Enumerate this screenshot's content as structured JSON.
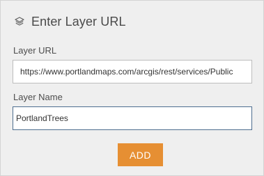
{
  "panel": {
    "title": "Enter Layer URL",
    "title_icon": "layers-icon"
  },
  "form": {
    "url_label": "Layer URL",
    "url_value": "https://www.portlandmaps.com/arcgis/rest/services/Public",
    "name_label": "Layer Name",
    "name_value": "PortlandTrees"
  },
  "actions": {
    "add_label": "ADD"
  },
  "colors": {
    "accent": "#e68f33",
    "panel_background": "#efefef",
    "focus_border": "#4d6d8f"
  }
}
